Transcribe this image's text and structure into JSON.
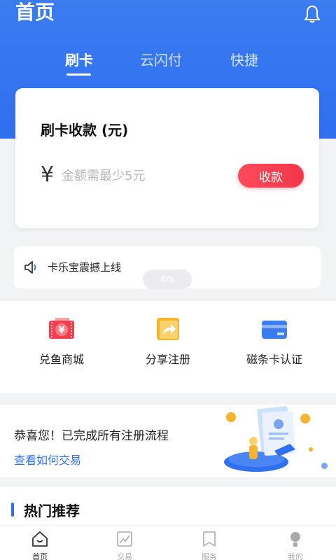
{
  "header": {
    "title": "首页",
    "bell_icon": "bell-icon"
  },
  "tabs": [
    {
      "label": "刷卡",
      "active": true
    },
    {
      "label": "云闪付",
      "active": false
    },
    {
      "label": "快捷",
      "active": false
    }
  ],
  "pay_card": {
    "title": "刷卡收款 (元)",
    "currency_symbol": "¥",
    "amount_value": "",
    "amount_placeholder": "金额需最少5元",
    "collect_label": "收款"
  },
  "notice": {
    "icon": "speaker-icon",
    "text": "卡乐宝震撼上线",
    "pill_text": "4/5"
  },
  "shortcuts": [
    {
      "label": "兑鱼商城",
      "icon": "ticket-icon",
      "color": "#f04050"
    },
    {
      "label": "分享注册",
      "icon": "share-icon",
      "color": "#f5b32e"
    },
    {
      "label": "磁条卡认证",
      "icon": "card-icon",
      "color": "#3a7cf0"
    }
  ],
  "banner": {
    "title": "恭喜您！已完成所有注册流程",
    "link": "查看如何交易"
  },
  "hot": {
    "title": "热门推荐"
  },
  "tabbar": [
    {
      "label": "首页",
      "icon": "home-icon",
      "active": true
    },
    {
      "label": "交易",
      "icon": "trend-icon",
      "active": false
    },
    {
      "label": "服务",
      "icon": "bookmark-icon",
      "active": false
    },
    {
      "label": "我的",
      "icon": "user-icon",
      "active": false
    }
  ],
  "colors": {
    "brand_blue": "#2f6ff0",
    "accent_red": "#f2364a"
  }
}
